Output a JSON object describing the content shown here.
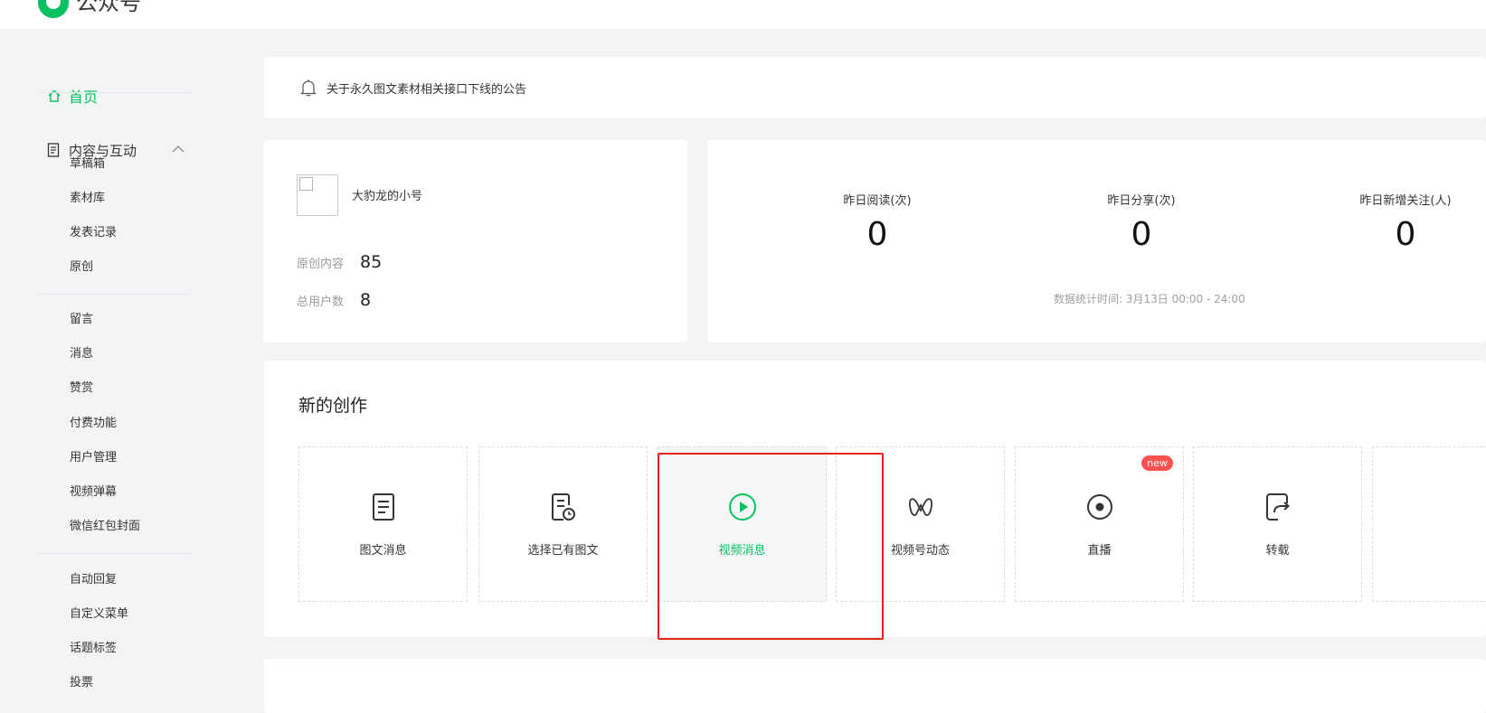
{
  "header": {
    "brand": "公众号",
    "accent": "#07c160"
  },
  "sidebar": {
    "home": "首页",
    "group": "内容与互动",
    "items": [
      "草稿箱",
      "素材库",
      "发表记录",
      "原创",
      "留言",
      "消息",
      "赞赏",
      "付费功能",
      "用户管理",
      "视频弹幕",
      "微信红包封面",
      "自动回复",
      "自定义菜单",
      "话题标签",
      "投票"
    ]
  },
  "notice": {
    "text": "关于永久图文素材相关接口下线的公告"
  },
  "account": {
    "name": "大豹龙的小号",
    "original_label": "原创内容",
    "original_value": "85",
    "users_label": "总用户数",
    "users_value": "8"
  },
  "stats": {
    "items": [
      {
        "label": "昨日阅读(次)",
        "value": "0"
      },
      {
        "label": "昨日分享(次)",
        "value": "0"
      },
      {
        "label": "昨日新增关注(人)",
        "value": "0"
      }
    ],
    "time": "数据统计时间: 3月13日 00:00 - 24:00"
  },
  "create": {
    "title": "新的创作",
    "tiles": [
      {
        "label": "图文消息",
        "icon": "article-icon"
      },
      {
        "label": "选择已有图文",
        "icon": "existing-article-icon"
      },
      {
        "label": "视频消息",
        "icon": "video-play-icon",
        "selected": true
      },
      {
        "label": "视频号动态",
        "icon": "channels-icon"
      },
      {
        "label": "直播",
        "icon": "live-icon",
        "badge": "new"
      },
      {
        "label": "转载",
        "icon": "repost-icon"
      }
    ]
  },
  "colors": {
    "highlight": "#e8231b",
    "badge": "#fa5151"
  }
}
